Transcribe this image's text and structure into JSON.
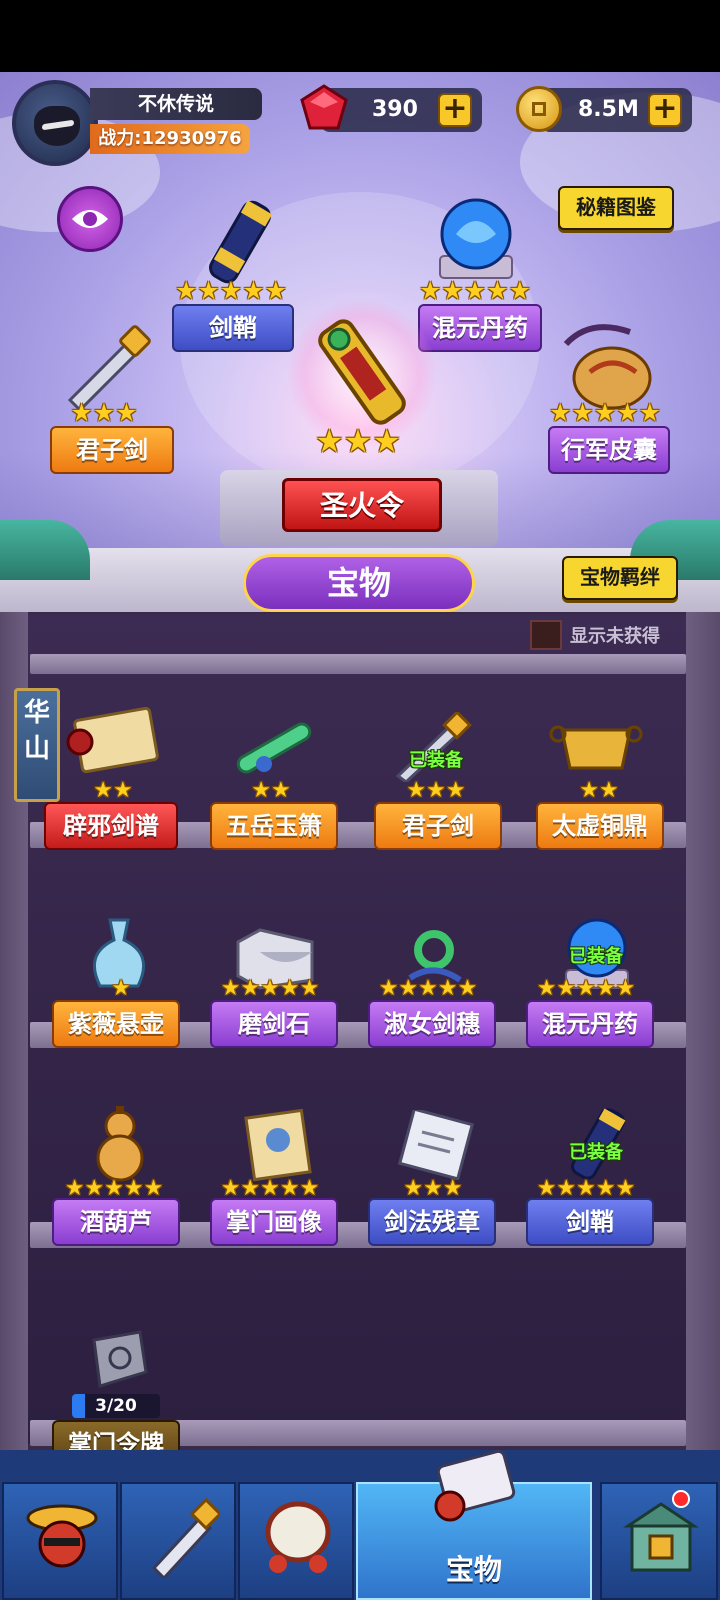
{
  "player": {
    "name": "不休传说",
    "power_label": "战力:",
    "power_value": "12930976"
  },
  "resources": {
    "gems": "390",
    "gold": "8.5M",
    "plus": "+"
  },
  "buttons": {
    "secret_book": "秘籍图鉴",
    "treasure_bond": "宝物羁绊",
    "show_unowned": "显示未获得"
  },
  "equipped_slots": [
    {
      "name": "剑鞘",
      "stars": "★★★★★",
      "style": "blue"
    },
    {
      "name": "混元丹药",
      "stars": "★★★★★",
      "style": "purple"
    },
    {
      "name": "君子剑",
      "stars": "★★★",
      "style": "orange"
    },
    {
      "name": "行军皮囊",
      "stars": "★★★★★",
      "style": "purple"
    },
    {
      "name": "圣火令",
      "stars": "★★★",
      "style": "red"
    }
  ],
  "section_title": "宝物",
  "sect_tag": "华山",
  "items": [
    {
      "name": "辟邪剑谱",
      "stars": "★★",
      "style": "red",
      "equipped": ""
    },
    {
      "name": "五岳玉箫",
      "stars": "★★",
      "style": "orange",
      "equipped": ""
    },
    {
      "name": "君子剑",
      "stars": "★★★",
      "style": "orange",
      "equipped": "已装备"
    },
    {
      "name": "太虚铜鼎",
      "stars": "★★",
      "style": "orange",
      "equipped": ""
    },
    {
      "name": "紫薇悬壶",
      "stars": "★",
      "style": "orange",
      "equipped": ""
    },
    {
      "name": "磨剑石",
      "stars": "★★★★★",
      "style": "purple",
      "equipped": ""
    },
    {
      "name": "淑女剑穗",
      "stars": "★★★★★",
      "style": "purple",
      "equipped": ""
    },
    {
      "name": "混元丹药",
      "stars": "★★★★★",
      "style": "purple",
      "equipped": "已装备"
    },
    {
      "name": "酒葫芦",
      "stars": "★★★★★",
      "style": "purple",
      "equipped": ""
    },
    {
      "name": "掌门画像",
      "stars": "★★★★★",
      "style": "purple",
      "equipped": ""
    },
    {
      "name": "剑法残章",
      "stars": "★★★",
      "style": "blue",
      "equipped": ""
    },
    {
      "name": "剑鞘",
      "stars": "★★★★★",
      "style": "blue",
      "equipped": "已装备"
    }
  ],
  "locked_item": {
    "name": "掌门令牌",
    "progress": "3/20",
    "progress_fraction": 0.15
  },
  "tabs": {
    "active_label": "宝物"
  }
}
